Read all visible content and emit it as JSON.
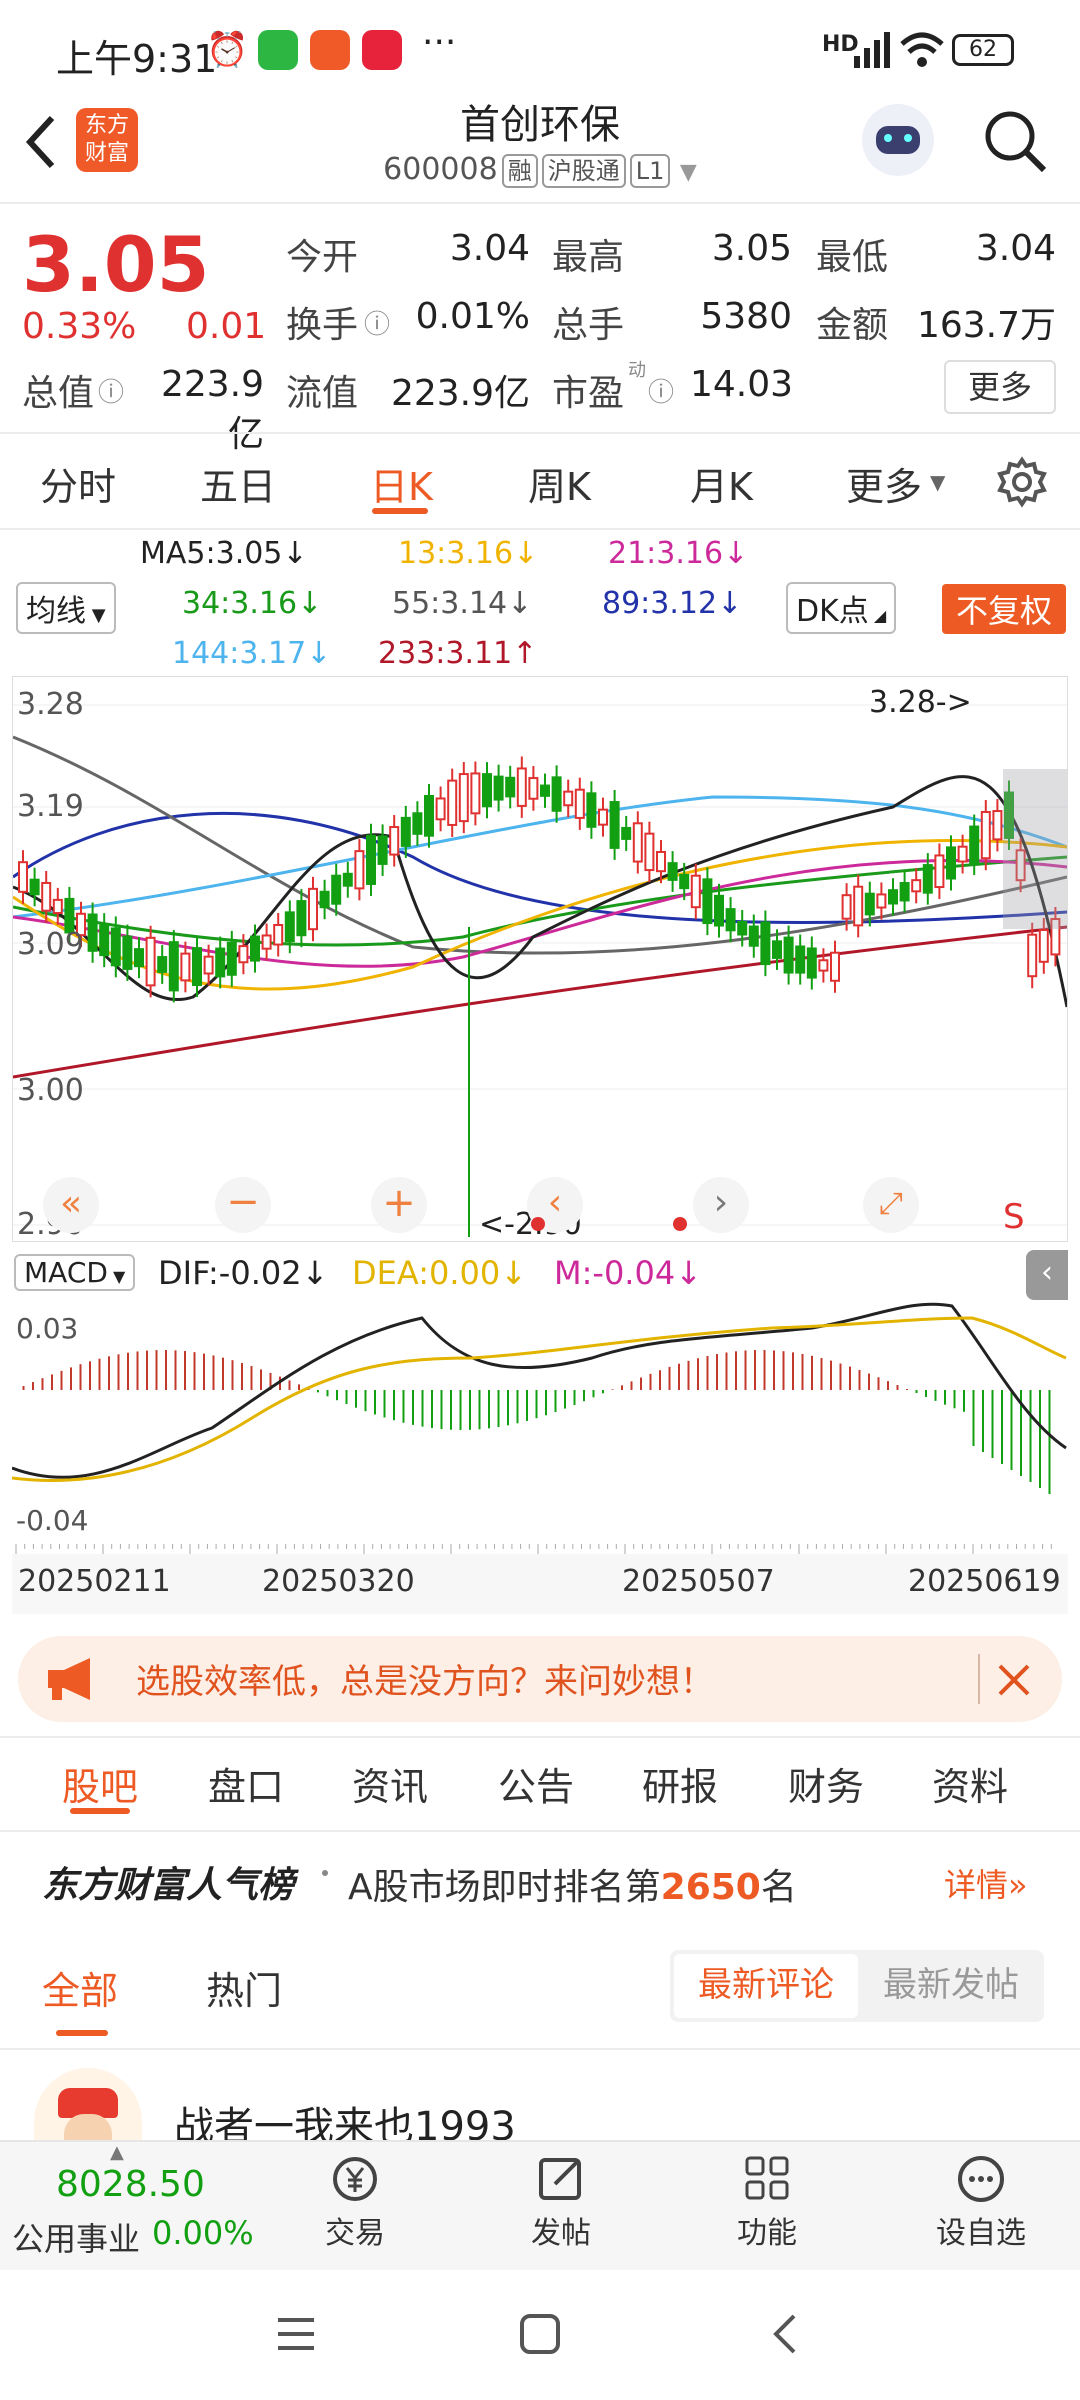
{
  "status_bar": {
    "time": "上午9:31",
    "battery": "62",
    "network": "HD"
  },
  "header": {
    "title": "首创环保",
    "code": "600008",
    "tags": [
      "融",
      "沪股通",
      "L1"
    ],
    "logo_text_1": "东方",
    "logo_text_2": "财富"
  },
  "quote": {
    "price": "3.05",
    "change_pct": "0.33%",
    "change": "0.01",
    "open_label": "今开",
    "open": "3.04",
    "high_label": "最高",
    "high": "3.05",
    "low_label": "最低",
    "low": "3.04",
    "turnover_label": "换手",
    "turnover": "0.01%",
    "volume_label": "总手",
    "volume": "5380",
    "amount_label": "金额",
    "amount": "163.7万",
    "mcap_label": "总值",
    "mcap": "223.9亿",
    "float_label": "流值",
    "float_cap": "223.9亿",
    "pe_label": "市盈",
    "pe_sup": "动",
    "pe": "14.03",
    "more": "更多"
  },
  "period_tabs": [
    "分时",
    "五日",
    "日K",
    "周K",
    "月K",
    "更多"
  ],
  "period_active": 2,
  "ma": {
    "selector": "均线",
    "ma5": "MA5:3.05↓",
    "ma13": "13:3.16↓",
    "ma21": "21:3.16↓",
    "ma34": "34:3.16↓",
    "ma55": "55:3.14↓",
    "ma89": "89:3.12↓",
    "ma144": "144:3.17↓",
    "ma233": "233:3.11↑",
    "dk": "DK点",
    "adjust": "不复权",
    "colors": {
      "ma5": "#222222",
      "ma13": "#f0b400",
      "ma21": "#cc2a9a",
      "ma34": "#1a9a1a",
      "ma55": "#666666",
      "ma89": "#2233aa",
      "ma144": "#4db4ee",
      "ma233": "#b0182a"
    }
  },
  "kline": {
    "y_labels": [
      "3.28",
      "3.19",
      "3.09",
      "3.00",
      "2.90"
    ],
    "high_note": "3.28->",
    "low_note": "<-2.90",
    "s_mark": "S"
  },
  "macd": {
    "selector": "MACD",
    "dif": "DIF:-0.02↓",
    "dea": "DEA:0.00↓",
    "m": "M:-0.04↓",
    "y_top": "0.03",
    "y_bottom": "-0.04"
  },
  "dates": [
    "20250211",
    "20250320",
    "20250507",
    "20250619"
  ],
  "banner": {
    "text": "选股效率低，总是没方向？来问妙想！"
  },
  "section_tabs": [
    "股吧",
    "盘口",
    "资讯",
    "公告",
    "研报",
    "财务",
    "资料"
  ],
  "rank": {
    "brand": "东方财富人气榜",
    "text_pre": "A股市场即时排名第",
    "rank_no": "2650",
    "text_post": "名",
    "detail": "详情"
  },
  "filter": {
    "all": "全部",
    "hot": "热门",
    "latest_comment": "最新评论",
    "latest_post": "最新发帖"
  },
  "post": {
    "author": "战者一我来也1993"
  },
  "bottom_nav": {
    "index_value": "8028.50",
    "index_name": "公用事业",
    "index_change": "0.00%",
    "items": [
      "交易",
      "发帖",
      "功能",
      "设自选"
    ]
  }
}
